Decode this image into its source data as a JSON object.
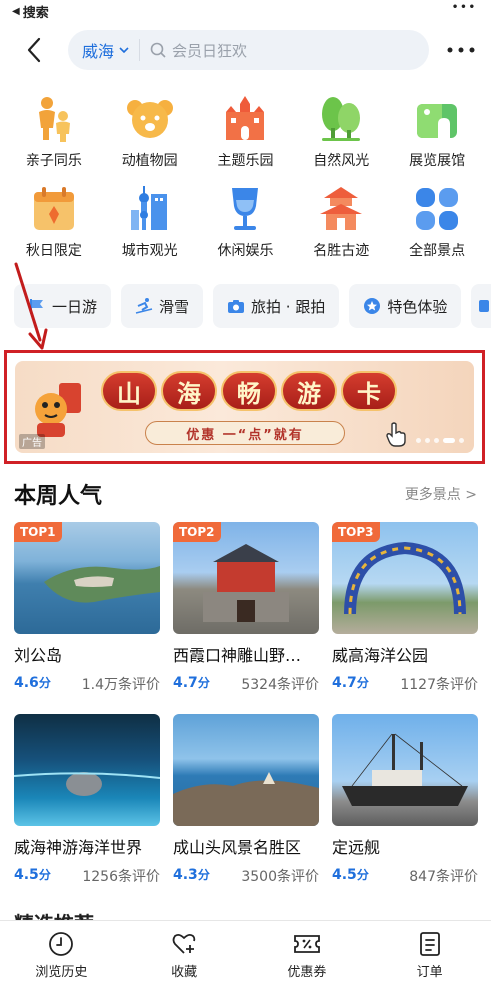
{
  "status_bar": {
    "back_label": "搜索",
    "signal": "•••"
  },
  "header": {
    "city": "威海",
    "search_placeholder": "会员日狂欢"
  },
  "categories": [
    {
      "label": "亲子同乐",
      "icon": "family-icon"
    },
    {
      "label": "动植物园",
      "icon": "koala-icon"
    },
    {
      "label": "主题乐园",
      "icon": "castle-icon"
    },
    {
      "label": "自然风光",
      "icon": "tree-icon"
    },
    {
      "label": "展览展馆",
      "icon": "museum-icon"
    },
    {
      "label": "秋日限定",
      "icon": "autumn-calendar-icon"
    },
    {
      "label": "城市观光",
      "icon": "city-tower-icon"
    },
    {
      "label": "休闲娱乐",
      "icon": "wine-glass-icon"
    },
    {
      "label": "名胜古迹",
      "icon": "pagoda-icon"
    },
    {
      "label": "全部景点",
      "icon": "grid-icon"
    }
  ],
  "chips": [
    {
      "label": "一日游"
    },
    {
      "label": "滑雪"
    },
    {
      "label": "旅拍 · 跟拍"
    },
    {
      "label": "特色体验"
    }
  ],
  "banner": {
    "title_chars": [
      "山",
      "海",
      "畅",
      "游",
      "卡"
    ],
    "subtitle": "优惠 一“点”就有",
    "ad_label": "广告"
  },
  "popular": {
    "title": "本周人气",
    "more": "更多景点 >",
    "items": [
      {
        "badge": "TOP1",
        "name": "刘公岛",
        "score": "4.6",
        "unit": "分",
        "reviews": "1.4万条评价"
      },
      {
        "badge": "TOP2",
        "name": "西霞口神雕山野…",
        "score": "4.7",
        "unit": "分",
        "reviews": "5324条评价"
      },
      {
        "badge": "TOP3",
        "name": "威高海洋公园",
        "score": "4.7",
        "unit": "分",
        "reviews": "1127条评价"
      },
      {
        "badge": "",
        "name": "威海神游海洋世界",
        "score": "4.5",
        "unit": "分",
        "reviews": "1256条评价"
      },
      {
        "badge": "",
        "name": "成山头风景名胜区",
        "score": "4.3",
        "unit": "分",
        "reviews": "3500条评价"
      },
      {
        "badge": "",
        "name": "定远舰",
        "score": "4.5",
        "unit": "分",
        "reviews": "847条评价"
      }
    ]
  },
  "next_section_peek": "精选推荐",
  "tabbar": [
    {
      "label": "浏览历史",
      "icon": "clock-icon"
    },
    {
      "label": "收藏",
      "icon": "heart-plus-icon"
    },
    {
      "label": "优惠券",
      "icon": "coupon-icon"
    },
    {
      "label": "订单",
      "icon": "order-icon"
    }
  ],
  "colors": {
    "accent": "#1f6fdc",
    "highlight_border": "#d02026",
    "badge": "#f06a3a"
  }
}
